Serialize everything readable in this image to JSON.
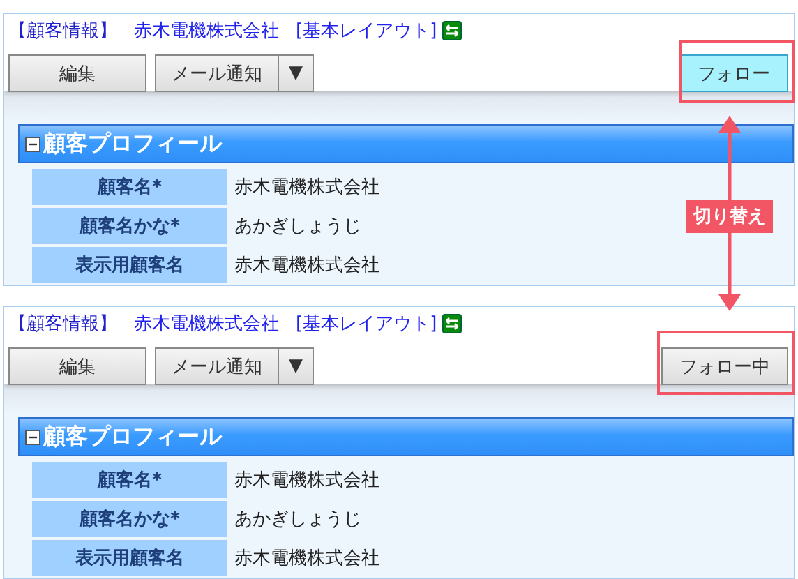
{
  "screens": [
    {
      "title_label": "【顧客情報】",
      "customer_link": "赤木電機株式会社",
      "layout_link": "[基本レイアウト]",
      "buttons": {
        "edit": "編集",
        "mail": "メール通知",
        "dropdown": "▼",
        "follow": {
          "label": "フォロー",
          "following": false
        }
      },
      "section_title": "顧客プロフィール",
      "fields": [
        {
          "label": "顧客名*",
          "value": "赤木電機株式会社"
        },
        {
          "label": "顧客名かな*",
          "value": "あかぎしょうじ"
        },
        {
          "label": "表示用顧客名",
          "value": "赤木電機株式会社"
        }
      ]
    },
    {
      "title_label": "【顧客情報】",
      "customer_link": "赤木電機株式会社",
      "layout_link": "[基本レイアウト]",
      "buttons": {
        "edit": "編集",
        "mail": "メール通知",
        "dropdown": "▼",
        "follow": {
          "label": "フォロー中",
          "following": true
        }
      },
      "section_title": "顧客プロフィール",
      "fields": [
        {
          "label": "顧客名*",
          "value": "赤木電機株式会社"
        },
        {
          "label": "顧客名かな*",
          "value": "あかぎしょうじ"
        },
        {
          "label": "表示用顧客名",
          "value": "赤木電機株式会社"
        }
      ]
    }
  ],
  "callout": {
    "label": "切り替え"
  }
}
